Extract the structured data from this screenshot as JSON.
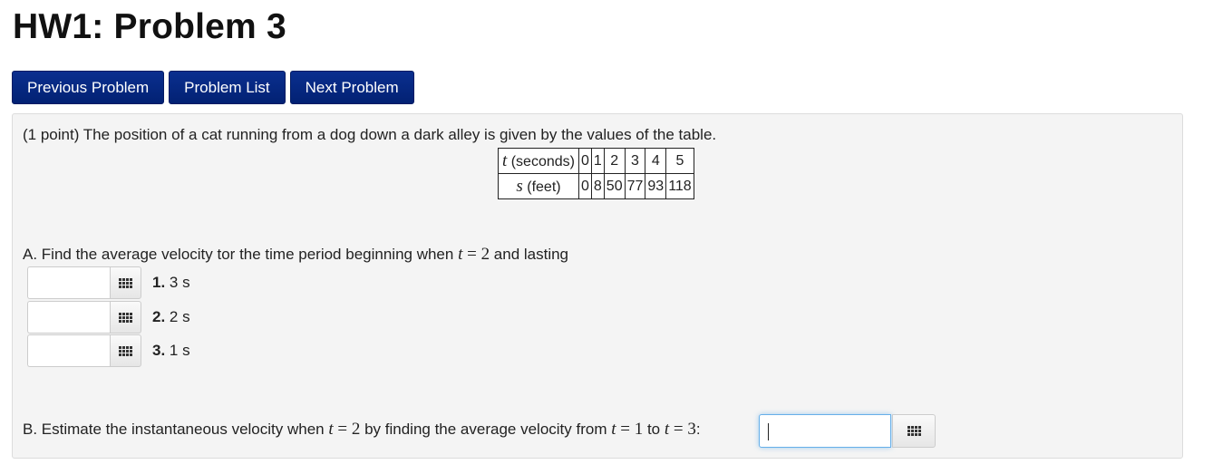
{
  "page": {
    "title": "HW1: Problem 3"
  },
  "nav": {
    "previous": "Previous Problem",
    "list": "Problem List",
    "next": "Next Problem"
  },
  "problem": {
    "intro": "(1 point) The position of a cat running from a dog down a dark alley is given by the values of the table.",
    "table": {
      "row1_var": "t",
      "row1_unit": " (seconds)",
      "row1_values": [
        "0",
        "1",
        "2",
        "3",
        "4",
        "5"
      ],
      "row2_var": "s",
      "row2_unit": " (feet)",
      "row2_values": [
        "0",
        "8",
        "50",
        "77",
        "93",
        "118"
      ]
    },
    "partA": {
      "text_before": "A. Find the average velocity tor the time period beginning when ",
      "var": "t",
      "equals": " = ",
      "value": "2",
      "text_after": " and lasting",
      "items": [
        {
          "num": "1.",
          "label": " 3 s",
          "value": ""
        },
        {
          "num": "2.",
          "label": " 2 s",
          "value": ""
        },
        {
          "num": "3.",
          "label": " 1 s",
          "value": ""
        }
      ]
    },
    "partB": {
      "text1": "B. Estimate the instantaneous velocity when ",
      "var1": "t",
      "eq1": " = ",
      "val1": "2",
      "text2": " by finding the average velocity from ",
      "var2": "t",
      "eq2": " = ",
      "val2": "1",
      "text3": " to ",
      "var3": "t",
      "eq3": " = ",
      "val3": "3",
      "text4": ":",
      "value": ""
    }
  }
}
